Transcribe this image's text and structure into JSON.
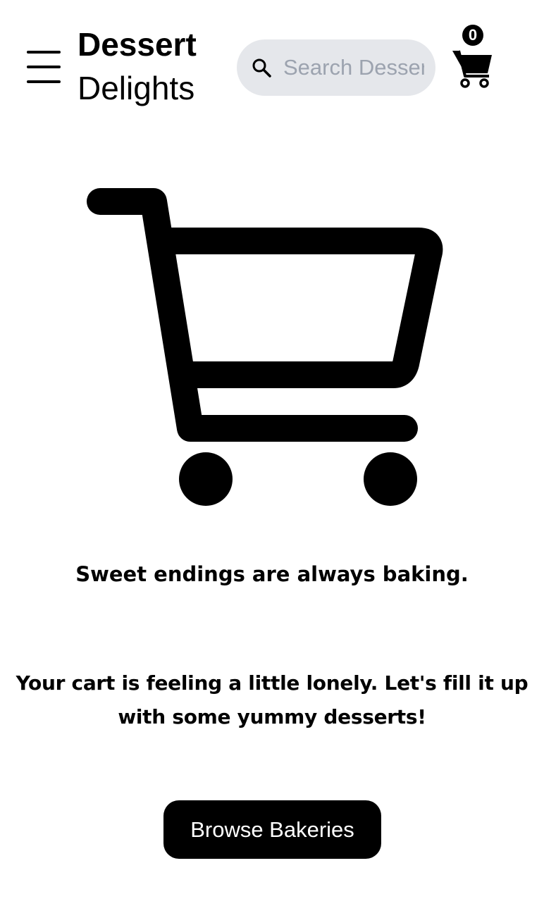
{
  "header": {
    "brand_line1": "Dessert",
    "brand_line2": "Delights",
    "search_placeholder": "Search Desserts",
    "cart_count": "0"
  },
  "main": {
    "headline": "Sweet endings are always baking.",
    "message": "Your cart is feeling a little lonely. Let's fill it up with some yummy desserts!",
    "browse_button": "Browse Bakeries"
  },
  "icons": {
    "menu": "menu-icon",
    "search": "search-icon",
    "cart": "cart-icon",
    "empty_cart": "empty-cart-icon"
  },
  "colors": {
    "search_bg": "#e5e7eb",
    "placeholder": "#9ca3af",
    "button_bg": "#000000",
    "button_text": "#ffffff"
  }
}
